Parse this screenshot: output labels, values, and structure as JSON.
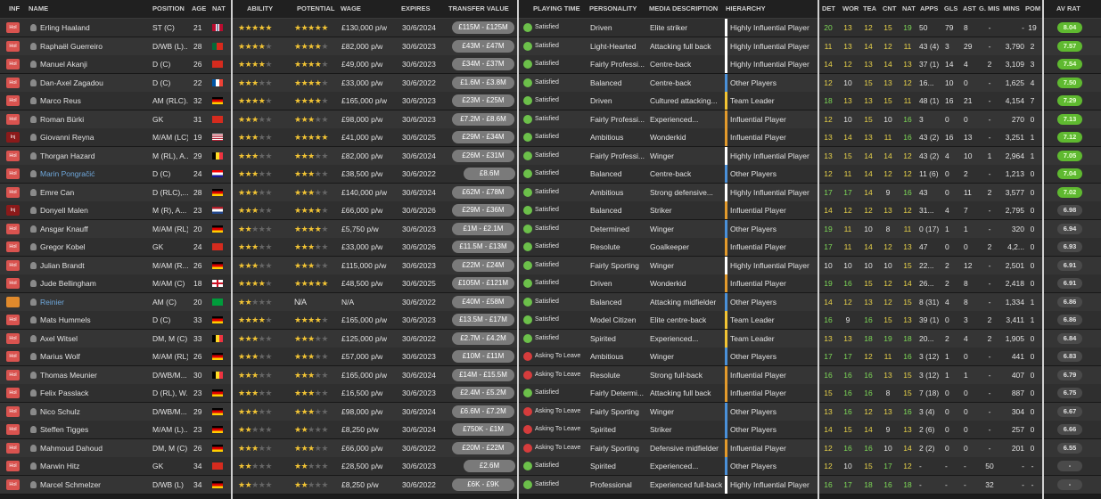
{
  "headers": {
    "inf": "INF",
    "name": "NAME",
    "position": "POSITION",
    "age": "AGE",
    "nat": "NAT",
    "ability": "ABILITY",
    "potential": "POTENTIAL",
    "wage": "WAGE",
    "expires": "EXPIRES",
    "transfer_value": "TRANSFER VALUE",
    "playing_time": "PLAYING TIME",
    "personality": "PERSONALITY",
    "media": "MEDIA DESCRIPTION",
    "hierarchy": "HIERARCHY",
    "det": "DET",
    "wor": "WOR",
    "tea": "TEA",
    "cnt": "CNT",
    "nat2": "NAT",
    "apps": "APPS",
    "gls": "GLS",
    "ast": "AST",
    "gmis": "G. MIS",
    "mins": "MINS",
    "pom": "POM",
    "avrat": "AV RAT"
  },
  "players": [
    {
      "inf": "Hol",
      "name": "Erling Haaland",
      "pos": "ST (C)",
      "age": "21",
      "flag": "no",
      "ab": 5,
      "pot": 5,
      "wage": "£130,000 p/w",
      "exp": "30/6/2024",
      "tv": "£115M - £125M",
      "pt": "Satisfied",
      "pers": "Driven",
      "media": "Elite striker",
      "hier": "Highly Influential Player",
      "det": "20",
      "wor": "13",
      "tea": "12",
      "cnt": "15",
      "nat": "19",
      "apps": "50",
      "gls": "79",
      "ast": "8",
      "gmis": "-",
      "mins": "-",
      "pom": "19",
      "avr": "8.04"
    },
    {
      "inf": "Hol",
      "name": "Raphaël Guerreiro",
      "pos": "D/WB (L)...",
      "age": "28",
      "flag": "pt",
      "ab": 3.5,
      "pot": 3.5,
      "wage": "£82,000 p/w",
      "exp": "30/6/2023",
      "tv": "£43M - £47M",
      "pt": "Satisfied",
      "pers": "Light-Hearted",
      "media": "Attacking full back",
      "hier": "Highly Influential Player",
      "det": "11",
      "wor": "13",
      "tea": "14",
      "cnt": "12",
      "nat": "11",
      "apps": "43 (4)",
      "gls": "3",
      "ast": "29",
      "gmis": "-",
      "mins": "3,790",
      "pom": "2",
      "avr": "7.57"
    },
    {
      "inf": "Hol",
      "name": "Manuel Akanji",
      "pos": "D (C)",
      "age": "26",
      "flag": "ch",
      "ab": 4,
      "pot": 4,
      "wage": "£49,000 p/w",
      "exp": "30/6/2023",
      "tv": "£34M - £37M",
      "pt": "Satisfied",
      "pers": "Fairly Professi...",
      "media": "Centre-back",
      "hier": "Highly Influential Player",
      "det": "14",
      "wor": "12",
      "tea": "13",
      "cnt": "14",
      "nat": "13",
      "apps": "37 (1)",
      "gls": "14",
      "ast": "4",
      "gmis": "2",
      "mins": "3,109",
      "pom": "3",
      "avr": "7.54"
    },
    {
      "inf": "Hol",
      "name": "Dan-Axel Zagadou",
      "pos": "D (C)",
      "age": "22",
      "flag": "fr",
      "ab": 3,
      "pot": 4,
      "wage": "£33,000 p/w",
      "exp": "30/6/2022",
      "tv": "£1.6M - £3.8M",
      "pt": "Satisfied",
      "pers": "Balanced",
      "media": "Centre-back",
      "hier": "Other Players",
      "det": "12",
      "wor": "10",
      "tea": "15",
      "cnt": "13",
      "nat": "12",
      "apps": "16...",
      "gls": "10",
      "ast": "0",
      "gmis": "-",
      "mins": "1,625",
      "pom": "4",
      "avr": "7.50"
    },
    {
      "inf": "Hol",
      "name": "Marco Reus",
      "pos": "AM (RLC)...",
      "age": "32",
      "flag": "de",
      "ab": 4,
      "pot": 4,
      "wage": "£165,000 p/w",
      "exp": "30/6/2023",
      "tv": "£23M - £25M",
      "pt": "Satisfied",
      "pers": "Driven",
      "media": "Cultured attacking...",
      "hier": "Team Leader",
      "det": "18",
      "wor": "13",
      "tea": "13",
      "cnt": "15",
      "nat": "11",
      "apps": "48 (1)",
      "gls": "16",
      "ast": "21",
      "gmis": "-",
      "mins": "4,154",
      "pom": "7",
      "avr": "7.29"
    },
    {
      "inf": "Hol",
      "name": "Roman Bürki",
      "pos": "GK",
      "age": "31",
      "flag": "ch",
      "ab": 2.5,
      "pot": 2.5,
      "wage": "£98,000 p/w",
      "exp": "30/6/2023",
      "tv": "£7.2M - £8.6M",
      "pt": "Satisfied",
      "pers": "Fairly Professi...",
      "media": "Experienced...",
      "hier": "Influential Player",
      "det": "12",
      "wor": "10",
      "tea": "15",
      "cnt": "10",
      "nat": "16",
      "apps": "3",
      "gls": "0",
      "ast": "0",
      "gmis": "-",
      "mins": "270",
      "pom": "0",
      "avr": "7.13"
    },
    {
      "inf": "Inj",
      "name": "Giovanni Reyna",
      "pos": "M/AM (LC)",
      "age": "19",
      "flag": "us",
      "ab": 3,
      "pot": 4.5,
      "wage": "£41,000 p/w",
      "exp": "30/6/2025",
      "tv": "£29M - £34M",
      "pt": "Satisfied",
      "pers": "Ambitious",
      "media": "Wonderkid",
      "hier": "Influential Player",
      "det": "13",
      "wor": "14",
      "tea": "13",
      "cnt": "11",
      "nat": "16",
      "apps": "43 (2)",
      "gls": "16",
      "ast": "13",
      "gmis": "-",
      "mins": "3,251",
      "pom": "1",
      "avr": "7.12"
    },
    {
      "inf": "Hol",
      "name": "Thorgan Hazard",
      "pos": "M (RL), A...",
      "age": "29",
      "flag": "be",
      "ab": 3,
      "pot": 3,
      "wage": "£82,000 p/w",
      "exp": "30/6/2024",
      "tv": "£26M - £31M",
      "pt": "Satisfied",
      "pers": "Fairly Professi...",
      "media": "Winger",
      "hier": "Highly Influential Player",
      "det": "13",
      "wor": "15",
      "tea": "14",
      "cnt": "14",
      "nat": "12",
      "apps": "43 (2)",
      "gls": "4",
      "ast": "10",
      "gmis": "1",
      "mins": "2,964",
      "pom": "1",
      "avr": "7.05"
    },
    {
      "inf": "Hol",
      "name": "Marin Pongračić",
      "pos": "D (C)",
      "age": "24",
      "flag": "hr",
      "ab": 2.5,
      "pot": 2.5,
      "wage": "£38,500 p/w",
      "exp": "30/6/2022",
      "tv": "£8.6M",
      "pt": "Satisfied",
      "pers": "Balanced",
      "media": "Centre-back",
      "hier": "Other Players",
      "det": "12",
      "wor": "11",
      "tea": "14",
      "cnt": "12",
      "nat": "12",
      "apps": "11 (6)",
      "gls": "0",
      "ast": "2",
      "gmis": "-",
      "mins": "1,213",
      "pom": "0",
      "avr": "7.04"
    },
    {
      "inf": "Hol",
      "name": "Emre Can",
      "pos": "D (RLC),...",
      "age": "28",
      "flag": "de",
      "ab": 3,
      "pot": 3,
      "wage": "£140,000 p/w",
      "exp": "30/6/2024",
      "tv": "£62M - £78M",
      "pt": "Satisfied",
      "pers": "Ambitious",
      "media": "Strong defensive...",
      "hier": "Highly Influential Player",
      "det": "17",
      "wor": "17",
      "tea": "14",
      "cnt": "9",
      "nat": "16",
      "apps": "43",
      "gls": "0",
      "ast": "11",
      "gmis": "2",
      "mins": "3,577",
      "pom": "0",
      "avr": "7.02"
    },
    {
      "inf": "Inj",
      "name": "Donyell Malen",
      "pos": "M (R), A...",
      "age": "23",
      "flag": "nl",
      "ab": 3,
      "pot": 3.5,
      "wage": "£66,000 p/w",
      "exp": "30/6/2026",
      "tv": "£29M - £36M",
      "pt": "Satisfied",
      "pers": "Balanced",
      "media": "Striker",
      "hier": "Influential Player",
      "det": "14",
      "wor": "12",
      "tea": "12",
      "cnt": "13",
      "nat": "12",
      "apps": "31...",
      "gls": "4",
      "ast": "7",
      "gmis": "-",
      "mins": "2,795",
      "pom": "0",
      "avr": "6.98"
    },
    {
      "inf": "Hol",
      "name": "Ansgar Knauff",
      "pos": "M/AM (RL)",
      "age": "20",
      "flag": "de",
      "ab": 2,
      "pot": 3.5,
      "wage": "£5,750 p/w",
      "exp": "30/6/2023",
      "tv": "£1M - £2.1M",
      "pt": "Satisfied",
      "pers": "Determined",
      "media": "Winger",
      "hier": "Other Players",
      "det": "19",
      "wor": "11",
      "tea": "10",
      "cnt": "8",
      "nat": "11",
      "apps": "0 (17)",
      "gls": "1",
      "ast": "1",
      "gmis": "-",
      "mins": "320",
      "pom": "0",
      "avr": "6.94"
    },
    {
      "inf": "Hol",
      "name": "Gregor Kobel",
      "pos": "GK",
      "age": "24",
      "flag": "ch",
      "ab": 3,
      "pot": 3,
      "wage": "£33,000 p/w",
      "exp": "30/6/2026",
      "tv": "£11.5M - £13M",
      "pt": "Satisfied",
      "pers": "Resolute",
      "media": "Goalkeeper",
      "hier": "Influential Player",
      "det": "17",
      "wor": "11",
      "tea": "14",
      "cnt": "12",
      "nat": "13",
      "apps": "47",
      "gls": "0",
      "ast": "0",
      "gmis": "2",
      "mins": "4,2...",
      "pom": "0",
      "avr": "6.93"
    },
    {
      "inf": "Hol",
      "name": "Julian Brandt",
      "pos": "M/AM (R...",
      "age": "26",
      "flag": "de",
      "ab": 3,
      "pot": 3,
      "wage": "£115,000 p/w",
      "exp": "30/6/2023",
      "tv": "£22M - £24M",
      "pt": "Satisfied",
      "pers": "Fairly Sporting",
      "media": "Winger",
      "hier": "Highly Influential Player",
      "det": "10",
      "wor": "10",
      "tea": "10",
      "cnt": "10",
      "nat": "15",
      "apps": "22...",
      "gls": "2",
      "ast": "12",
      "gmis": "-",
      "mins": "2,501",
      "pom": "0",
      "avr": "6.91"
    },
    {
      "inf": "Hol",
      "name": "Jude Bellingham",
      "pos": "M/AM (C)",
      "age": "18",
      "flag": "en",
      "ab": 3.5,
      "pot": 5,
      "wage": "£48,500 p/w",
      "exp": "30/6/2025",
      "tv": "£105M - £121M",
      "pt": "Satisfied",
      "pers": "Driven",
      "media": "Wonderkid",
      "hier": "Influential Player",
      "det": "19",
      "wor": "16",
      "tea": "15",
      "cnt": "12",
      "nat": "14",
      "apps": "26...",
      "gls": "2",
      "ast": "8",
      "gmis": "-",
      "mins": "2,418",
      "pom": "0",
      "avr": "6.91"
    },
    {
      "inf": "Hol2",
      "name": "Reinier",
      "pos": "AM (C)",
      "age": "20",
      "flag": "br",
      "ab": 2,
      "pot": "N/A",
      "wage": "N/A",
      "exp": "30/6/2022",
      "tv": "£40M - £58M",
      "pt": "Satisfied",
      "pers": "Balanced",
      "media": "Attacking midfielder",
      "hier": "Other Players",
      "det": "14",
      "wor": "12",
      "tea": "13",
      "cnt": "12",
      "nat": "15",
      "apps": "8 (31)",
      "gls": "4",
      "ast": "8",
      "gmis": "-",
      "mins": "1,334",
      "pom": "1",
      "avr": "6.86"
    },
    {
      "inf": "Hol",
      "name": "Mats Hummels",
      "pos": "D (C)",
      "age": "33",
      "flag": "de",
      "ab": 4,
      "pot": 4,
      "wage": "£165,000 p/w",
      "exp": "30/6/2023",
      "tv": "£13.5M - £17M",
      "pt": "Satisfied",
      "pers": "Model Citizen",
      "media": "Elite centre-back",
      "hier": "Team Leader",
      "det": "16",
      "wor": "9",
      "tea": "16",
      "cnt": "15",
      "nat": "13",
      "apps": "39 (1)",
      "gls": "0",
      "ast": "3",
      "gmis": "2",
      "mins": "3,411",
      "pom": "1",
      "avr": "6.86"
    },
    {
      "inf": "Hol",
      "name": "Axel Witsel",
      "pos": "DM, M (C)",
      "age": "33",
      "flag": "be",
      "ab": 3,
      "pot": 3,
      "wage": "£125,000 p/w",
      "exp": "30/6/2022",
      "tv": "£2.7M - £4.2M",
      "pt": "Satisfied",
      "pers": "Spirited",
      "media": "Experienced...",
      "hier": "Team Leader",
      "det": "13",
      "wor": "13",
      "tea": "18",
      "cnt": "19",
      "nat": "18",
      "apps": "20...",
      "gls": "2",
      "ast": "4",
      "gmis": "2",
      "mins": "1,905",
      "pom": "0",
      "avr": "6.84"
    },
    {
      "inf": "Hol",
      "name": "Marius Wolf",
      "pos": "M/AM (RL)",
      "age": "26",
      "flag": "de",
      "ab": 2.5,
      "pot": 2.5,
      "wage": "£57,000 p/w",
      "exp": "30/6/2023",
      "tv": "£10M - £11M",
      "pt": "Asking To Leave",
      "pers": "Ambitious",
      "media": "Winger",
      "hier": "Other Players",
      "det": "17",
      "wor": "17",
      "tea": "12",
      "cnt": "11",
      "nat": "16",
      "apps": "3 (12)",
      "gls": "1",
      "ast": "0",
      "gmis": "-",
      "mins": "441",
      "pom": "0",
      "avr": "6.83"
    },
    {
      "inf": "Hol",
      "name": "Thomas Meunier",
      "pos": "D/WB/M...",
      "age": "30",
      "flag": "be",
      "ab": 2.5,
      "pot": 2.5,
      "wage": "£165,000 p/w",
      "exp": "30/6/2024",
      "tv": "£14M - £15.5M",
      "pt": "Asking To Leave",
      "pers": "Resolute",
      "media": "Strong full-back",
      "hier": "Influential Player",
      "det": "16",
      "wor": "16",
      "tea": "16",
      "cnt": "13",
      "nat": "15",
      "apps": "3 (12)",
      "gls": "1",
      "ast": "1",
      "gmis": "-",
      "mins": "407",
      "pom": "0",
      "avr": "6.79"
    },
    {
      "inf": "Hol",
      "name": "Felix Passlack",
      "pos": "D (RL), W...",
      "age": "23",
      "flag": "de",
      "ab": 2.5,
      "pot": 2.5,
      "wage": "£16,500 p/w",
      "exp": "30/6/2023",
      "tv": "£2.4M - £5.2M",
      "pt": "Satisfied",
      "pers": "Fairly Determi...",
      "media": "Attacking full back",
      "hier": "Influential Player",
      "det": "15",
      "wor": "16",
      "tea": "16",
      "cnt": "8",
      "nat": "15",
      "apps": "7 (18)",
      "gls": "0",
      "ast": "0",
      "gmis": "-",
      "mins": "887",
      "pom": "0",
      "avr": "6.75"
    },
    {
      "inf": "Hol",
      "name": "Nico Schulz",
      "pos": "D/WB/M...",
      "age": "29",
      "flag": "de",
      "ab": 2.5,
      "pot": 2.5,
      "wage": "£98,000 p/w",
      "exp": "30/6/2024",
      "tv": "£6.6M - £7.2M",
      "pt": "Asking To Leave",
      "pers": "Fairly Sporting",
      "media": "Winger",
      "hier": "Other Players",
      "det": "13",
      "wor": "16",
      "tea": "12",
      "cnt": "13",
      "nat": "16",
      "apps": "3 (4)",
      "gls": "0",
      "ast": "0",
      "gmis": "-",
      "mins": "304",
      "pom": "0",
      "avr": "6.67"
    },
    {
      "inf": "Hol",
      "name": "Steffen Tigges",
      "pos": "M/AM (L)...",
      "age": "23",
      "flag": "de",
      "ab": 1.5,
      "pot": 2,
      "wage": "£8,250 p/w",
      "exp": "30/6/2024",
      "tv": "£750K - £1M",
      "pt": "Asking To Leave",
      "pers": "Spirited",
      "media": "Striker",
      "hier": "Other Players",
      "det": "14",
      "wor": "15",
      "tea": "14",
      "cnt": "9",
      "nat": "13",
      "apps": "2 (6)",
      "gls": "0",
      "ast": "0",
      "gmis": "-",
      "mins": "257",
      "pom": "0",
      "avr": "6.66"
    },
    {
      "inf": "Hol",
      "name": "Mahmoud Dahoud",
      "pos": "DM, M (C)",
      "age": "26",
      "flag": "de",
      "ab": 2.5,
      "pot": 2.5,
      "wage": "£66,000 p/w",
      "exp": "30/6/2022",
      "tv": "£20M - £22M",
      "pt": "Asking To Leave",
      "pers": "Fairly Sporting",
      "media": "Defensive midfielder",
      "hier": "Influential Player",
      "det": "12",
      "wor": "16",
      "tea": "16",
      "cnt": "10",
      "nat": "14",
      "apps": "2 (2)",
      "gls": "0",
      "ast": "0",
      "gmis": "-",
      "mins": "201",
      "pom": "0",
      "avr": "6.55"
    },
    {
      "inf": "Hol",
      "name": "Marwin Hitz",
      "pos": "GK",
      "age": "34",
      "flag": "ch",
      "ab": 2,
      "pot": 2,
      "wage": "£28,500 p/w",
      "exp": "30/6/2023",
      "tv": "£2.6M",
      "pt": "Satisfied",
      "pers": "Spirited",
      "media": "Experienced...",
      "hier": "Other Players",
      "det": "12",
      "wor": "10",
      "tea": "15",
      "cnt": "17",
      "nat": "12",
      "apps": "-",
      "gls": "-",
      "ast": "-",
      "gmis": "50",
      "mins": "-",
      "pom": "-",
      "avr": "-"
    },
    {
      "inf": "Hol",
      "name": "Marcel Schmelzer",
      "pos": "D/WB (L)",
      "age": "34",
      "flag": "de",
      "ab": 1.5,
      "pot": 1.5,
      "wage": "£8,250 p/w",
      "exp": "30/6/2022",
      "tv": "£6K - £9K",
      "pt": "Satisfied",
      "pers": "Professional",
      "media": "Experienced full-back",
      "hier": "Highly Influential Player",
      "det": "16",
      "wor": "17",
      "tea": "18",
      "cnt": "16",
      "nat": "18",
      "apps": "-",
      "gls": "-",
      "ast": "-",
      "gmis": "32",
      "mins": "-",
      "pom": "-",
      "avr": "-"
    }
  ],
  "colors": {
    "accent": "#5fb930",
    "gold": "#f2c434",
    "link": "#6fa8dc"
  }
}
